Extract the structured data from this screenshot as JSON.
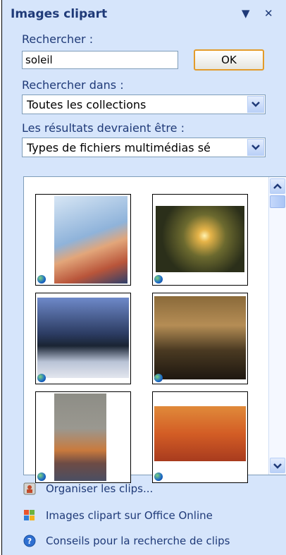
{
  "pane": {
    "title": "Images clipart",
    "menu_glyph": "▼",
    "close_glyph": "✕"
  },
  "search": {
    "label": "Rechercher :",
    "value": "soleil",
    "ok_label": "OK"
  },
  "search_in": {
    "label": "Rechercher dans :",
    "selected": "Toutes les collections"
  },
  "results_type": {
    "label": "Les résultats devraient être :",
    "selected": "Types de fichiers multimédias sé"
  },
  "results": {
    "items": [
      {
        "name": "woman-sunglasses"
      },
      {
        "name": "sun-in-sky"
      },
      {
        "name": "winter-trees"
      },
      {
        "name": "forest-sunset"
      },
      {
        "name": "evening-sky"
      },
      {
        "name": "martial-arts-sunset"
      }
    ]
  },
  "links": [
    {
      "label": "Organiser les clips...",
      "icon": "organize-clips-icon"
    },
    {
      "label": "Images clipart sur Office Online",
      "icon": "office-online-icon"
    },
    {
      "label": "Conseils pour la recherche de clips",
      "icon": "help-icon"
    }
  ],
  "colors": {
    "pane_bg": "#d6e5fb",
    "title": "#1f3a78",
    "ok_border": "#e39b2a"
  }
}
